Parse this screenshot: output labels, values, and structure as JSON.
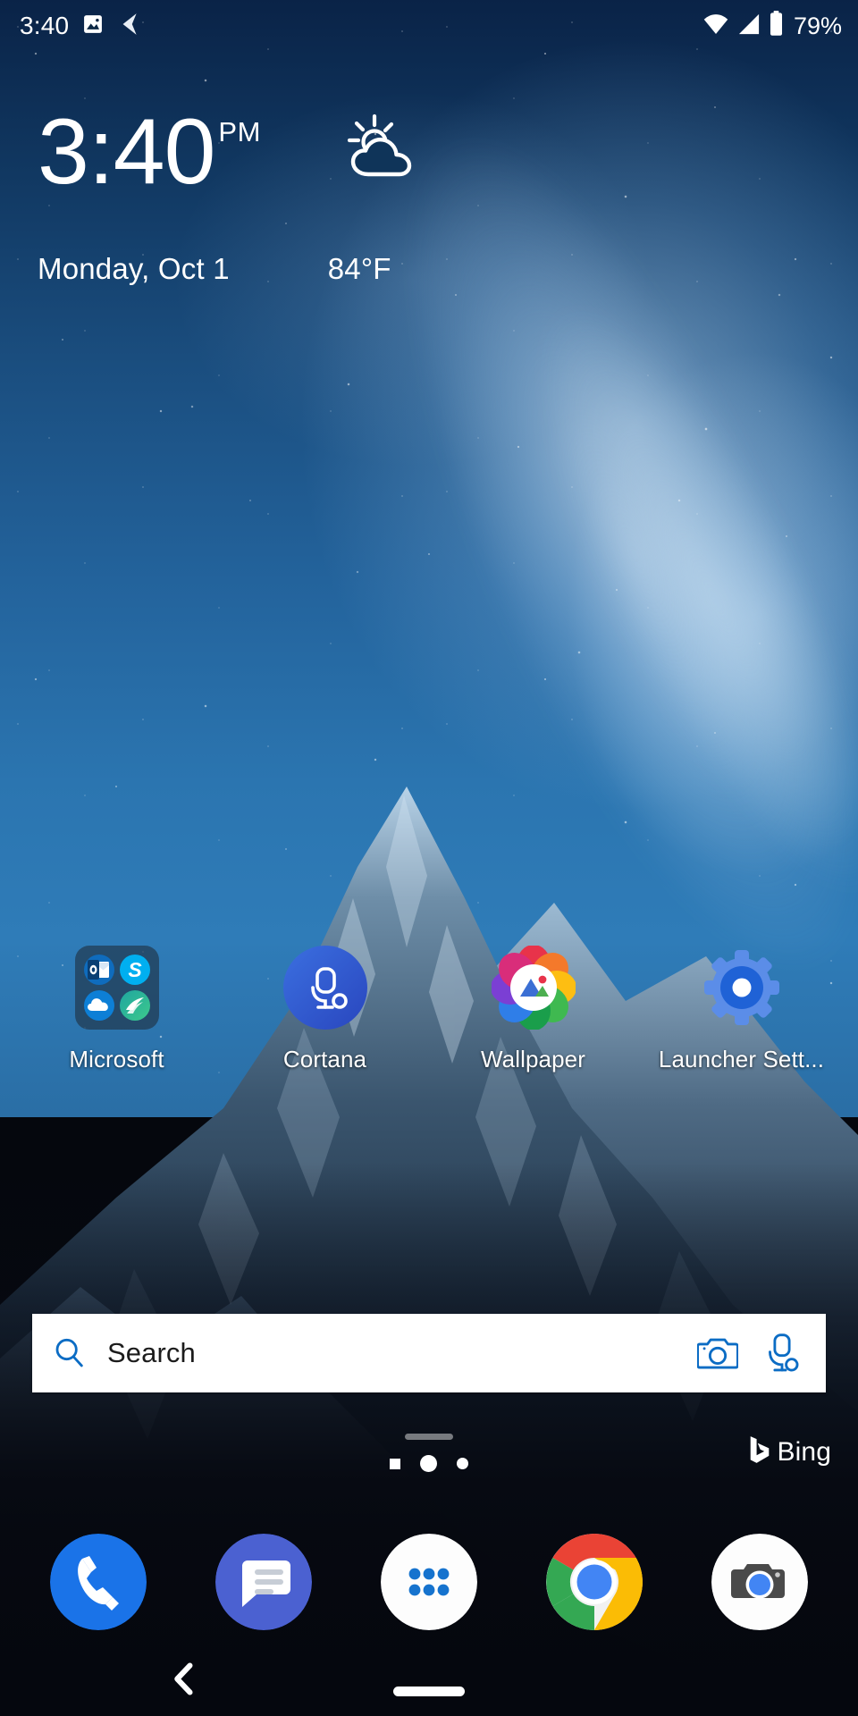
{
  "status_bar": {
    "time": "3:40",
    "battery_percent": "79%",
    "icons": [
      "image-notification-icon",
      "back-gesture-icon",
      "wifi-icon",
      "cellular-signal-icon",
      "battery-icon"
    ]
  },
  "clock_widget": {
    "time": "3:40",
    "am_pm": "PM",
    "date": "Monday, Oct 1",
    "temperature": "84°F",
    "weather_icon": "partly-cloudy-icon"
  },
  "apps": [
    {
      "label": "Microsoft",
      "type": "folder",
      "contents": [
        "Outlook",
        "Skype",
        "OneDrive",
        "SwiftKey"
      ]
    },
    {
      "label": "Cortana",
      "type": "app",
      "icon": "cortana-icon"
    },
    {
      "label": "Wallpaper",
      "type": "app",
      "icon": "wallpaper-icon"
    },
    {
      "label": "Launcher Sett...",
      "type": "app",
      "icon": "launcher-settings-gear-icon"
    }
  ],
  "search": {
    "placeholder": "Search",
    "search_icon": "search-icon",
    "camera_label": "camera-search-icon",
    "voice_label": "cortana-voice-icon",
    "brand": "Bing"
  },
  "page_indicator": {
    "pages": 3,
    "current": 2
  },
  "dock": [
    {
      "label": "Phone",
      "icon": "phone-icon"
    },
    {
      "label": "Messages",
      "icon": "messages-icon"
    },
    {
      "label": "All Apps",
      "icon": "app-drawer-icon"
    },
    {
      "label": "Chrome",
      "icon": "chrome-icon"
    },
    {
      "label": "Camera",
      "icon": "camera-icon"
    }
  ],
  "nav_bar": {
    "back": "back-icon",
    "home": "home-pill"
  },
  "colors": {
    "accent_blue": "#0B6CC4",
    "search_bg": "#FFFFFF",
    "text_on_wallpaper": "#FFFFFF",
    "cortana_blue": "#2B5BD7",
    "phone_blue": "#1A73E8",
    "messages_indigo": "#4B61D1"
  }
}
